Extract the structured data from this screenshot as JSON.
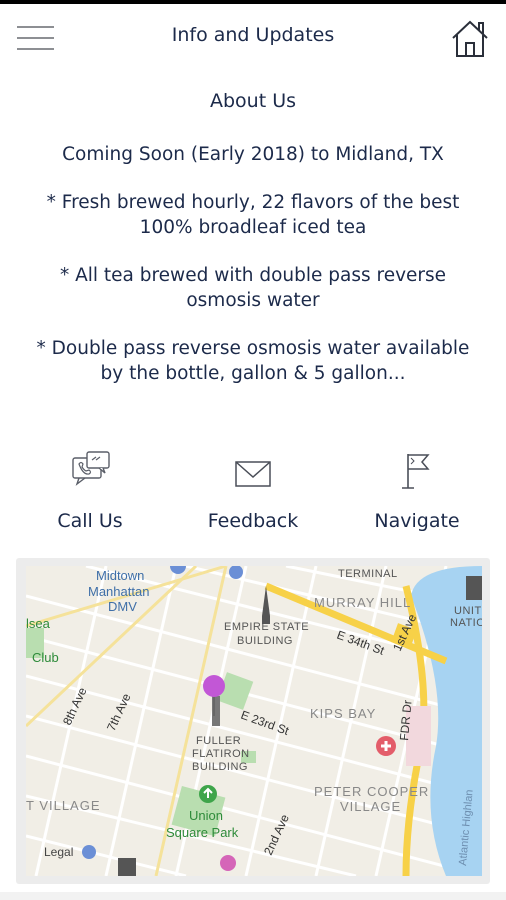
{
  "header": {
    "title": "Info and Updates",
    "menu_icon": "hamburger-menu-icon",
    "home_icon": "home-icon"
  },
  "content": {
    "heading": "About Us",
    "lines": [
      "Coming Soon (Early 2018) to Midland, TX",
      "* Fresh brewed hourly, 22 flavors of the best 100% broadleaf iced tea",
      "* All tea brewed with double pass reverse osmosis water",
      "* Double pass reverse osmosis water available by the bottle, gallon & 5 gallon..."
    ]
  },
  "actions": [
    {
      "label": "Call Us",
      "icon": "phone-chat-icon"
    },
    {
      "label": "Feedback",
      "icon": "envelope-icon"
    },
    {
      "label": "Navigate",
      "icon": "flag-icon"
    }
  ],
  "map": {
    "labels": {
      "midtown": "Midtown",
      "manhattan_dmv": "Manhattan",
      "dmv": "DMV",
      "terminal": "TERMINAL",
      "murray_hill": "MURRAY HILL",
      "united_nations": "UNITED",
      "nations": "NATIONS",
      "chelsea": "lsea",
      "club": "Club",
      "empire_state": "EMPIRE STATE",
      "building1": "BUILDING",
      "e34th": "E 34th St",
      "first_ave": "1st Ave",
      "eighth_ave": "8th Ave",
      "seventh_ave": "7th Ave",
      "e23rd": "E 23rd St",
      "kips_bay": "KIPS BAY",
      "fdr": "FDR Dr",
      "fuller": "FULLER",
      "flatiron": "FLATIRON",
      "building2": "BUILDING",
      "village": "T VILLAGE",
      "peter_cooper": "PETER COOPER",
      "village2": "VILLAGE",
      "union": "Union",
      "square_park": "Square Park",
      "second_ave": "2nd Ave",
      "atlantic": "Atlantic Highlan",
      "legal": "Legal"
    },
    "colors": {
      "land": "#f1eee6",
      "water": "#a7d3f2",
      "highway": "#f7d148",
      "park": "#b9deb0",
      "pin": "#c257d6"
    }
  }
}
